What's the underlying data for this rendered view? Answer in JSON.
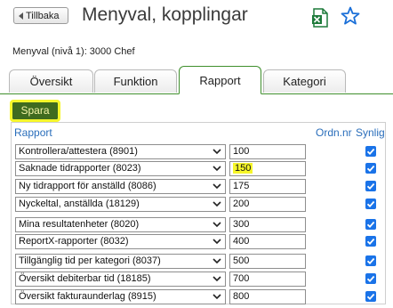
{
  "header": {
    "back_label": "Tillbaka",
    "title": "Menyval, kopplingar",
    "export_icon": "excel-icon",
    "favorite_icon": "star-icon"
  },
  "menu_level": "Menyval (nivå 1): 3000 Chef",
  "tabs": [
    {
      "label": "Översikt",
      "active": false
    },
    {
      "label": "Funktion",
      "active": false
    },
    {
      "label": "Rapport",
      "active": true
    },
    {
      "label": "Kategori",
      "active": false
    }
  ],
  "toolbar": {
    "save_label": "Spara"
  },
  "table": {
    "headers": {
      "report": "Rapport",
      "order": "Ordn.nr",
      "visible": "Synlig"
    },
    "rows": [
      {
        "report": "Kontrollera/attestera (8901)",
        "order": "100",
        "visible": true,
        "highlight": false
      },
      {
        "report": "Saknade tidrapporter (8023)",
        "order": "150",
        "visible": true,
        "highlight": true
      },
      {
        "report": "Ny tidrapport för anställd (8086)",
        "order": "175",
        "visible": true,
        "highlight": false
      },
      {
        "report": "Nyckeltal, anställda (18129)",
        "order": "200",
        "visible": true,
        "highlight": false
      },
      {
        "report": "Mina resultatenheter (8020)",
        "order": "300",
        "visible": true,
        "highlight": false
      },
      {
        "report": "ReportX-rapporter (8032)",
        "order": "400",
        "visible": true,
        "highlight": false
      },
      {
        "report": "Tillgänglig tid per kategori (8037)",
        "order": "500",
        "visible": true,
        "highlight": false
      },
      {
        "report": "Översikt debiterbar tid (18185)",
        "order": "700",
        "visible": true,
        "highlight": false
      },
      {
        "report": "Översikt fakturaunderlag (8915)",
        "order": "800",
        "visible": true,
        "highlight": false
      }
    ]
  },
  "colors": {
    "accent_green": "#3f8f2d",
    "save_button_bg": "#3f6b1f",
    "highlight_yellow": "#f6f62a",
    "link_blue": "#2a6ebb",
    "checkbox_blue": "#1a73e8"
  }
}
